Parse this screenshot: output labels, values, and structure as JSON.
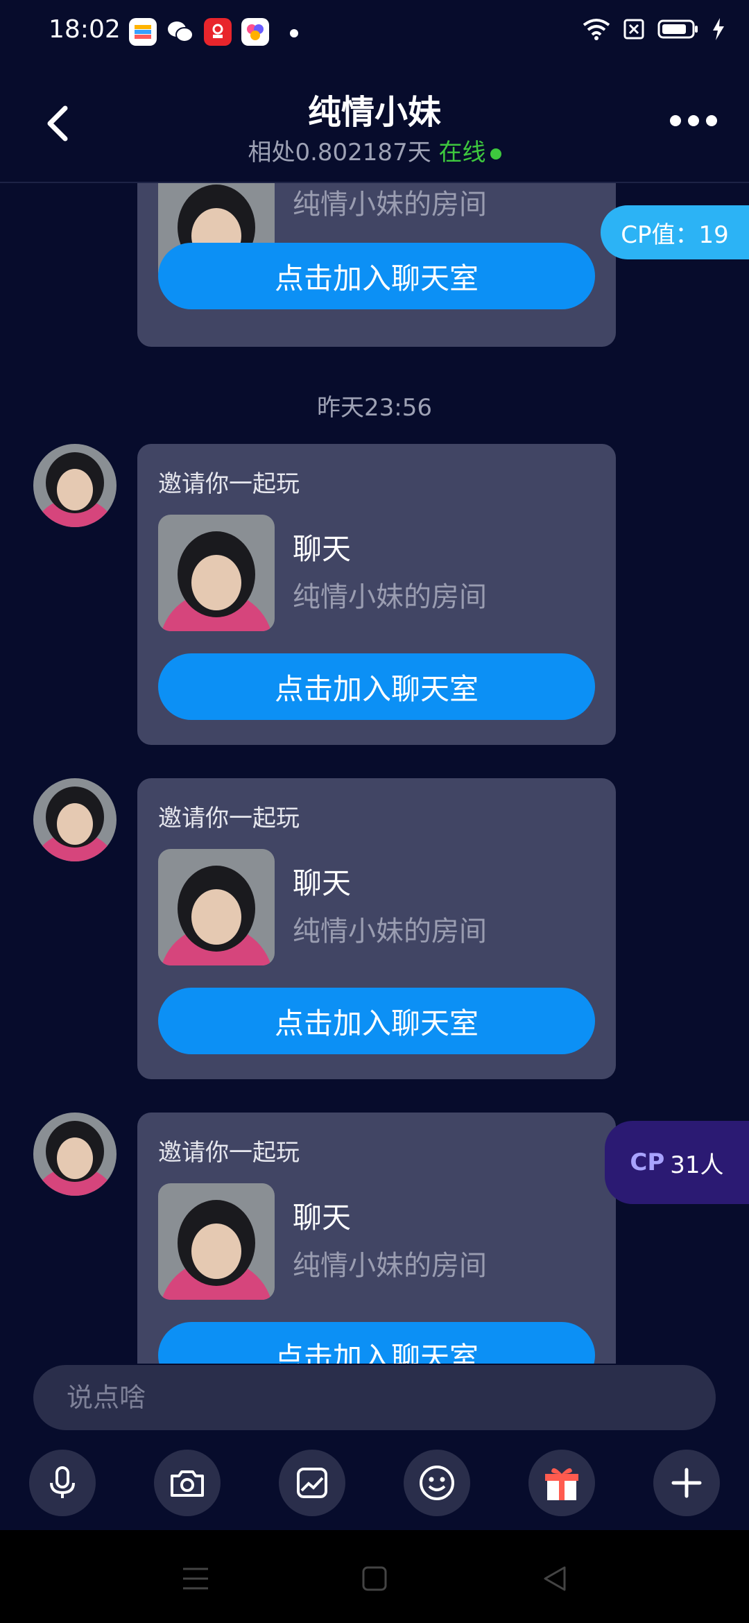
{
  "status_bar": {
    "time": "18:02"
  },
  "header": {
    "title": "纯情小妹",
    "subtitle_days": "相处0.802187天",
    "online": "在线"
  },
  "cp_value": "CP值：19",
  "cp_count": {
    "tag": "CP",
    "value": "31人"
  },
  "messages": [
    {
      "label": "",
      "room_title": "",
      "room_sub": "纯情小妹的房间",
      "button": "点击加入聊天室"
    },
    {
      "label": "邀请你一起玩",
      "room_title": "聊天",
      "room_sub": "纯情小妹的房间",
      "button": "点击加入聊天室"
    },
    {
      "label": "邀请你一起玩",
      "room_title": "聊天",
      "room_sub": "纯情小妹的房间",
      "button": "点击加入聊天室"
    },
    {
      "label": "邀请你一起玩",
      "room_title": "聊天",
      "room_sub": "纯情小妹的房间",
      "button": "点击加入聊天室"
    }
  ],
  "timestamp": "昨天23:56",
  "input": {
    "placeholder": "说点啥"
  },
  "toolbar_icons": [
    "microphone-icon",
    "camera-icon",
    "image-icon",
    "emoji-icon",
    "gift-icon",
    "plus-icon"
  ],
  "colors": {
    "accent": "#0c90f5",
    "online": "#3ec83e",
    "card": "#414564",
    "background": "#070c2c"
  }
}
